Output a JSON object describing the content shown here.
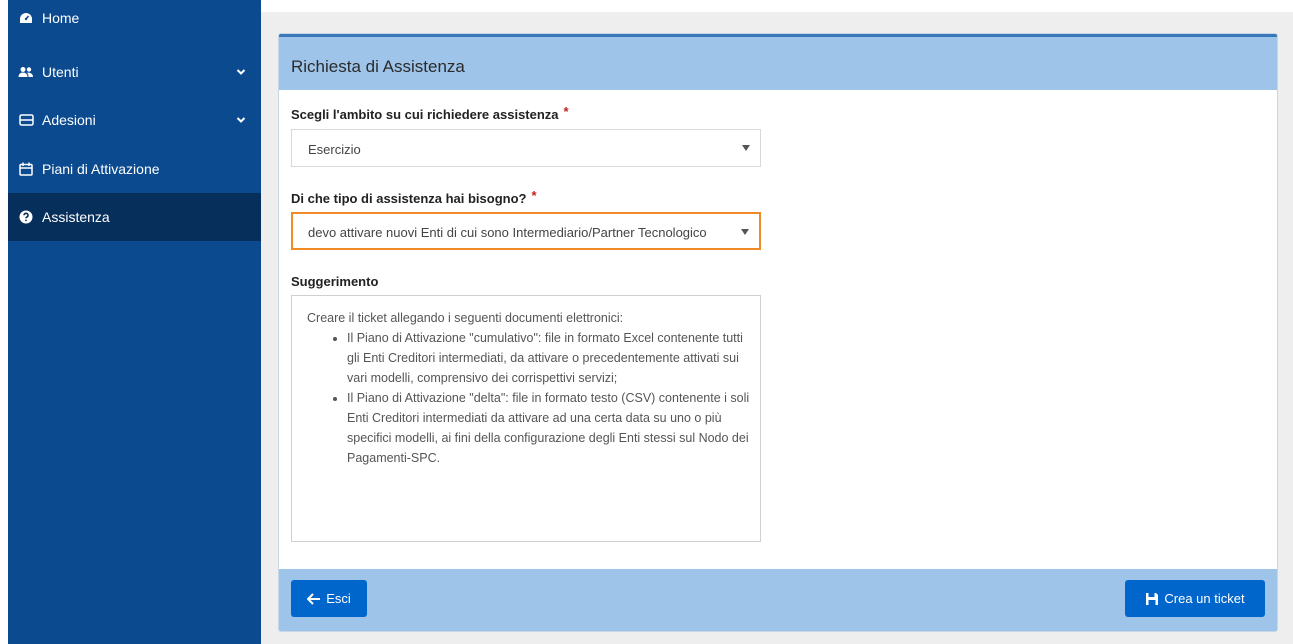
{
  "sidebar": {
    "items": [
      {
        "label": "Home",
        "icon": "dashboard-icon"
      },
      {
        "label": "Utenti",
        "icon": "users-icon",
        "has_chevron": true
      },
      {
        "label": "Adesioni",
        "icon": "document-icon",
        "has_chevron": true
      },
      {
        "label": "Piani di Attivazione",
        "icon": "calendar-icon"
      },
      {
        "label": "Assistenza",
        "icon": "question-icon",
        "active": true
      }
    ]
  },
  "panel": {
    "title": "Richiesta di Assistenza",
    "ambito_label": "Scegli l'ambito su cui richiedere assistenza",
    "ambito_value": "Esercizio",
    "tipo_label": "Di che tipo di assistenza hai bisogno?",
    "tipo_value": "devo attivare nuovi Enti di cui sono Intermediario/Partner Tecnologico",
    "required_mark": "*",
    "hint_label": "Suggerimento",
    "hint_intro": "Creare il ticket allegando i seguenti documenti elettronici:",
    "hint_items": [
      "Il Piano di Attivazione \"cumulativo\": file in formato Excel contenente tutti gli Enti Creditori intermediati, da attivare o precedentemente attivati sui vari modelli, comprensivo dei corrispettivi servizi;",
      "Il Piano di Attivazione \"delta\": file in formato testo (CSV) contenente i soli Enti Creditori intermediati da attivare ad una certa data su uno o più specifici modelli, ai fini della configurazione degli Enti stessi sul Nodo dei Pagamenti-SPC."
    ]
  },
  "footer": {
    "back_label": "Esci",
    "ticket_label": "Crea un ticket"
  },
  "colors": {
    "sidebar": "#0b4a8f",
    "sidebar_active": "#062f5c",
    "header": "#9ec4ea",
    "button": "#0066cc",
    "focus_border": "#f08a24",
    "required": "#c0201e"
  }
}
